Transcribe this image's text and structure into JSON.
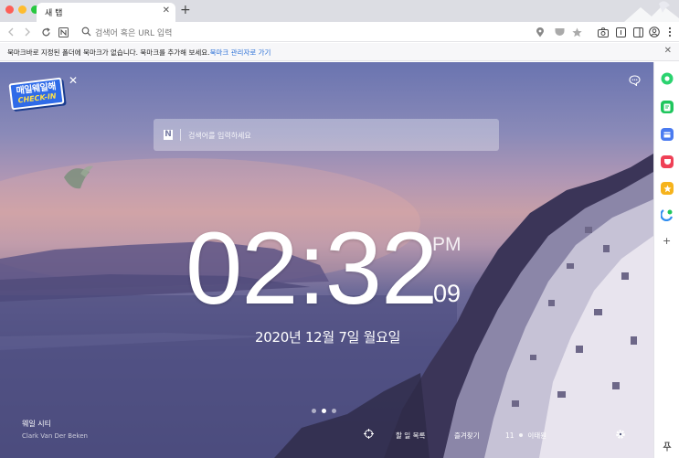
{
  "tab": {
    "title": "새 탭",
    "close": "✕",
    "new_tab": "+"
  },
  "toolbar": {
    "url_placeholder": "검색어 혹은 URL 입력"
  },
  "bookmark_bar": {
    "message": "북마크바로 지정된 폴더에 북마크가 없습니다. 북마크를 추가해 보세요.",
    "link": "북마크 관리자로 가기",
    "close": "✕"
  },
  "content": {
    "checkin_top": "매일웨일해",
    "checkin_bottom": "CHECK-IN",
    "close": "✕",
    "search_logo": "N",
    "search_placeholder": "검색어를 입력하세요",
    "clock": {
      "time": "02:32",
      "ampm": "PM",
      "seconds": "09"
    },
    "date": "2020년 12월 7일 월요일",
    "slide_dots": {
      "count": 3,
      "active": 2
    },
    "background": {
      "place": "웨일 시티",
      "credit": "Clark Van Der Beken"
    },
    "bottom_bar": {
      "todo": "할 일 목록",
      "favorites": "즐겨찾기",
      "weather_temp": "11",
      "weather_place": "이태원"
    }
  },
  "sidebar": {
    "items": [
      {
        "name": "green-circle",
        "color": "#2bd36f"
      },
      {
        "name": "green-note",
        "color": "#1fc65d"
      },
      {
        "name": "blue-calendar",
        "color": "#4a7bf0"
      },
      {
        "name": "red-pocket",
        "color": "#ef4056"
      },
      {
        "name": "star",
        "color": "#f6b31c"
      },
      {
        "name": "translate",
        "color": "#2f8cf0"
      }
    ],
    "add": "+"
  }
}
